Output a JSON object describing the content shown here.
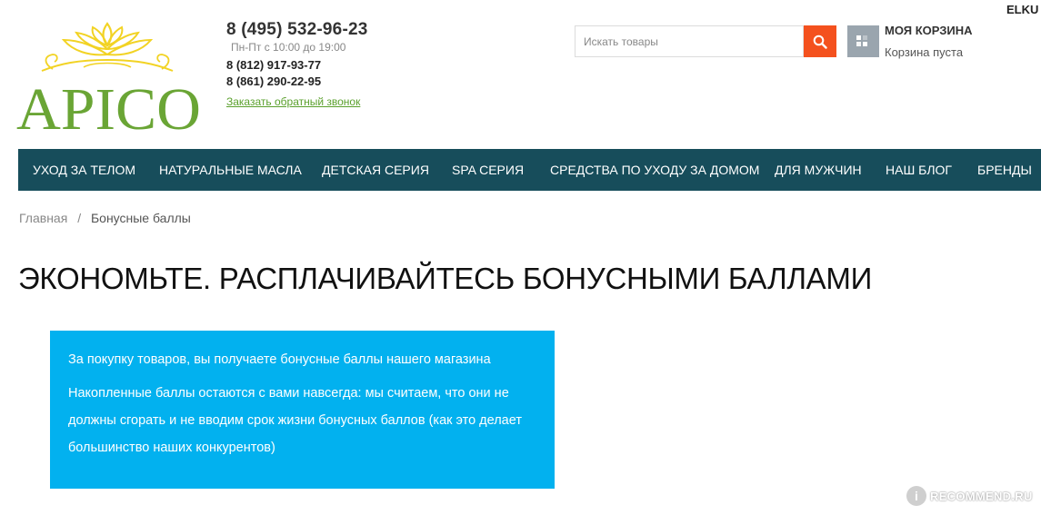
{
  "brand": {
    "name": "APICO"
  },
  "header": {
    "user_login": "ELKU",
    "phone_main": "8 (495) 532-96-23",
    "hours": "Пн-Пт с 10:00 до 19:00",
    "phone_2": "8 (812) 917-93-77",
    "phone_3": "8 (861) 290-22-95",
    "callback_link": "Заказать обратный звонок"
  },
  "search": {
    "placeholder": "Искать товары",
    "value": ""
  },
  "cart": {
    "title": "МОЯ КОРЗИНА",
    "status": "Корзина пуста"
  },
  "nav": {
    "items": [
      {
        "label": "УХОД ЗА ТЕЛОМ"
      },
      {
        "label": "НАТУРАЛЬНЫЕ МАСЛА"
      },
      {
        "label": "ДЕТСКАЯ СЕРИЯ"
      },
      {
        "label": "SPA СЕРИЯ"
      },
      {
        "label": "СРЕДСТВА ПО УХОДУ ЗА ДОМОМ"
      },
      {
        "label": "ДЛЯ МУЖЧИН"
      },
      {
        "label": "НАШ БЛОГ"
      },
      {
        "label": "БРЕНДЫ"
      }
    ]
  },
  "breadcrumb": {
    "home": "Главная",
    "separator": "/",
    "current": "Бонусные баллы"
  },
  "page": {
    "title": "ЭКОНОМЬТЕ. РАСПЛАЧИВАЙТЕСЬ БОНУСНЫМИ БАЛЛАМИ",
    "info_line_1": "За покупку товаров, вы получаете бонусные баллы нашего магазина",
    "info_line_2": "Накопленные баллы остаются с вами навсегда: мы считаем, что они не должны сгорать и не вводим срок жизни бонусных баллов (как это делает большинство наших конкурентов)"
  },
  "watermark": {
    "badge": "i",
    "text": "RECOMMEND.RU"
  },
  "colors": {
    "nav_bg": "#174d5b",
    "search_button": "#f4511e",
    "cart_icon_bg": "#9aa5ae",
    "info_box_bg": "#02b1ef",
    "link_green": "#5aa02c",
    "logo_gold": "#f2d324",
    "logo_green": "#6aa535"
  },
  "icons": {
    "search_button": "search-icon",
    "cart": "cart-icon",
    "logo_ornament": "lotus-ornament-icon"
  }
}
